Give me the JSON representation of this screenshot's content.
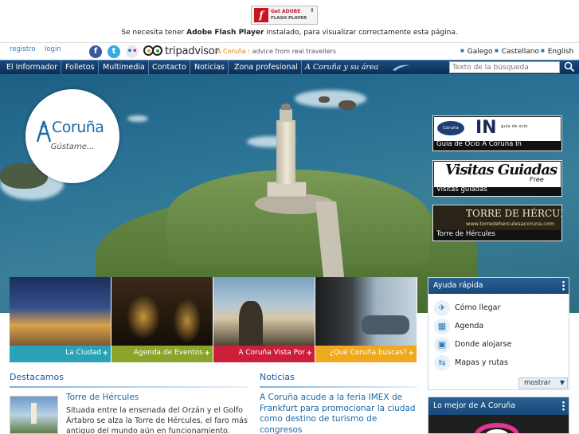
{
  "flash": {
    "badge_line1": "Get ADOBE",
    "badge_line2": "FLASH PLAYER",
    "message_pre": "Se necesita tener ",
    "message_bold": "Adobe Flash Player",
    "message_post": " instalado, para visualizar correctamente esta página."
  },
  "utility": {
    "register": "registro",
    "login": "login",
    "tripadvisor_brand": "tripadvisor",
    "tripadvisor_place": "A Coruña",
    "tripadvisor_tagline": " : advice from real travellers",
    "languages": [
      "Galego",
      "Castellano",
      "English"
    ]
  },
  "nav": {
    "items": [
      "El Informador",
      "Folletos",
      "Multimedia",
      "Contacto",
      "Noticias",
      "Zona profesional"
    ],
    "brand": "A Coruña  y  su  área",
    "search_placeholder": "Texto de la búsqueda"
  },
  "hero": {
    "logo_text": "Coruña",
    "logo_slogan": "Gústame..."
  },
  "promos": [
    {
      "banner_big": "IN",
      "banner_small": "guía de ocio",
      "caption": "Guía de Ocio A Coruña In"
    },
    {
      "banner_big": "Visitas Guiadas",
      "banner_small": "Free",
      "caption": "Visitas guiadas"
    },
    {
      "banner_big": "TORRE DE HÉRCULES",
      "banner_small": "www.torredeherculesacoruna.com",
      "caption": "Torre de Hércules"
    }
  ],
  "tiles": [
    {
      "label": "La Ciudad",
      "color": "#2aa3b8"
    },
    {
      "label": "Agenda de Eventos",
      "color": "#8aa529"
    },
    {
      "label": "A Coruña Vista Por",
      "color": "#cc1f3a"
    },
    {
      "label": "¿Qué Coruña buscas?",
      "color": "#f0a81c"
    }
  ],
  "quick_help": {
    "title": "Ayuda rápida",
    "items": [
      {
        "label": "Cómo llegar",
        "icon": "plane-icon"
      },
      {
        "label": "Agenda",
        "icon": "calendar-icon"
      },
      {
        "label": "Donde alojarse",
        "icon": "suitcase-icon"
      },
      {
        "label": "Mapas y rutas",
        "icon": "signpost-icon"
      }
    ],
    "more_label": "mostrar"
  },
  "featured": {
    "section_title": "Destacamos",
    "title": "Torre de Hércules",
    "text": "Situada entre la ensenada del Orzán y el Golfo Ártabro se alza la Torre de Hércules, el faro más antiguo del mundo aún en funcionamiento."
  },
  "news": {
    "section_title": "Noticias",
    "title": "A Coruña acude a la feria IMEX de Frankfurt para promocionar la ciudad como destino de turismo de congresos"
  },
  "best": {
    "title": "Lo mejor de A Coruña"
  }
}
